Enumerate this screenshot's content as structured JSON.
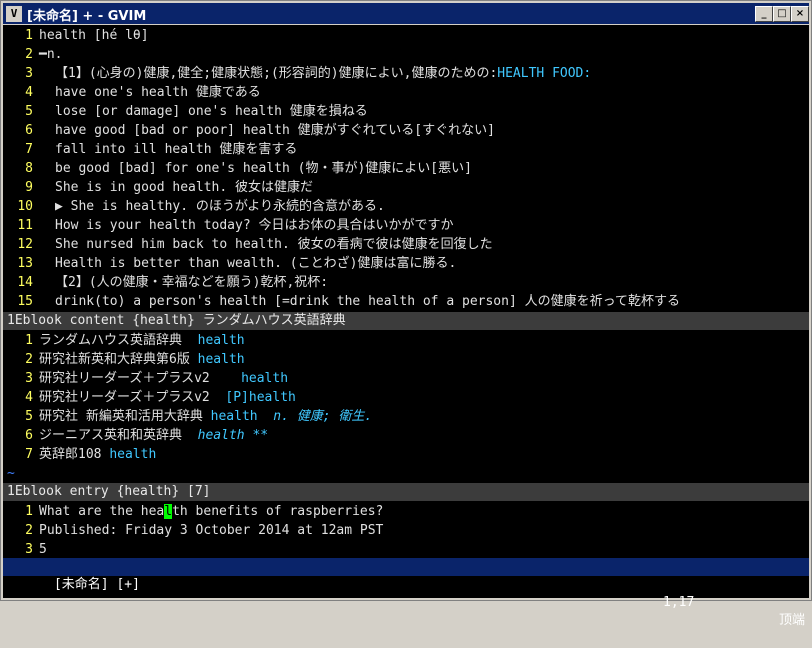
{
  "title": "[未命名] + - GVIM",
  "buttons": {
    "minimize": "_",
    "maximize": "□",
    "close": "×"
  },
  "main_lines": [
    {
      "n": "1",
      "text": "health [hé lθ]"
    },
    {
      "n": "2",
      "text": "━n."
    },
    {
      "n": "3",
      "text": "【1】(心身の)健康,健全;健康状態;(形容詞的)健康によい,健康のための:",
      "accent": "HEALTH FOOD:"
    },
    {
      "n": "4",
      "text": "have one's health 健康である"
    },
    {
      "n": "5",
      "text": "lose [or damage] one's health 健康を損ねる"
    },
    {
      "n": "6",
      "text": "have good [bad or poor] health 健康がすぐれている[すぐれない]"
    },
    {
      "n": "7",
      "text": "fall into ill health 健康を害する"
    },
    {
      "n": "8",
      "text": "be good [bad] for one's health (物・事が)健康によい[悪い]"
    },
    {
      "n": "9",
      "text": "She is in good health. 彼女は健康だ"
    },
    {
      "n": "10",
      "text": "▶ She is healthy. のほうがより永続的含意がある."
    },
    {
      "n": "11",
      "text": "How is your health today? 今日はお体の具合はいかがですか"
    },
    {
      "n": "12",
      "text": "She nursed him back to health. 彼女の看病で彼は健康を回復した"
    },
    {
      "n": "13",
      "text": "Health is better than wealth. (ことわざ)健康は富に勝る."
    },
    {
      "n": "14",
      "text": "【2】(人の健康・幸福などを願う)乾杯,祝杯:"
    },
    {
      "n": "15",
      "text": "drink(to) a person's health [=drink the health of a person] 人の健康を祈って乾杯する"
    }
  ],
  "status1": "1Eblook content {health} ランダムハウス英語辞典",
  "content_lines": [
    {
      "n": "1",
      "dict": "ランダムハウス英語辞典  ",
      "word": "health",
      "extra": ""
    },
    {
      "n": "2",
      "dict": "研究社新英和大辞典第6版 ",
      "word": "health",
      "extra": ""
    },
    {
      "n": "3",
      "dict": "研究社リーダーズ＋プラスv2    ",
      "word": "health",
      "extra": ""
    },
    {
      "n": "4",
      "dict": "研究社リーダーズ＋プラスv2  ",
      "word": "[P]health",
      "extra": ""
    },
    {
      "n": "5",
      "dict": "研究社 新編英和活用大辞典 ",
      "word": "health  ",
      "extra": "n. 健康; 衛生."
    },
    {
      "n": "6",
      "dict": "ジーニアス英和和英辞典  ",
      "word": "health **",
      "extra": ""
    },
    {
      "n": "7",
      "dict": "英辞郎108 ",
      "word": "health",
      "extra": ""
    }
  ],
  "tilde": "~",
  "status2": "1Eblook entry {health} [7]",
  "entry_lines": [
    {
      "n": "1",
      "before": "What are the hea",
      "cursor": "l",
      "after": "th benefits of raspberries?"
    },
    {
      "n": "2",
      "before": "Published: Friday 3 October 2014 at 12am PST",
      "cursor": "",
      "after": ""
    },
    {
      "n": "3",
      "before": "5",
      "cursor": "",
      "after": ""
    }
  ],
  "status3": "[未命名] [+]",
  "status3_pos": "1,17",
  "status3_scroll": "顶端"
}
